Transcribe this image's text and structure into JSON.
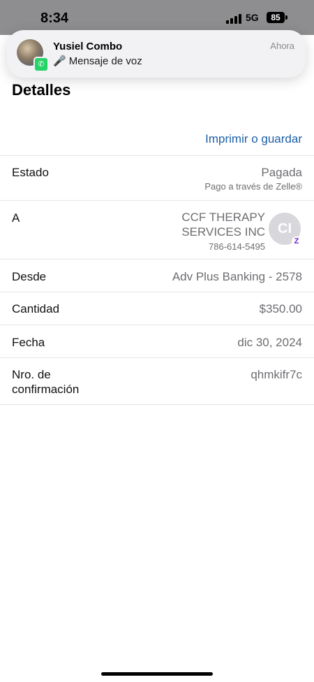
{
  "status_bar": {
    "time": "8:34",
    "network": "5G",
    "battery": "85"
  },
  "notification": {
    "sender": "Yusiel Combo",
    "time": "Ahora",
    "message": "Mensaje de voz",
    "app_icon": "whatsapp-icon",
    "message_icon": "microphone-icon"
  },
  "page": {
    "title": "Detalles",
    "print_link": "Imprimir o guardar"
  },
  "details": {
    "estado": {
      "label": "Estado",
      "value": "Pagada",
      "sub": "Pago a través de Zelle®"
    },
    "recipient": {
      "label": "A",
      "name_line1": "CCF THERAPY",
      "name_line2": "SERVICES INC",
      "phone": "786-614-5495",
      "initials": "CI"
    },
    "desde": {
      "label": "Desde",
      "value": "Adv Plus Banking - 2578"
    },
    "cantidad": {
      "label": "Cantidad",
      "value": "$350.00"
    },
    "fecha": {
      "label": "Fecha",
      "value": "dic 30, 2024"
    },
    "confirmacion": {
      "label_line1": "Nro. de",
      "label_line2": "confirmación",
      "value": "qhmkifr7c"
    }
  },
  "colors": {
    "link": "#1b5fa8",
    "zelle": "#6d1ed4",
    "whatsapp": "#25d366"
  }
}
